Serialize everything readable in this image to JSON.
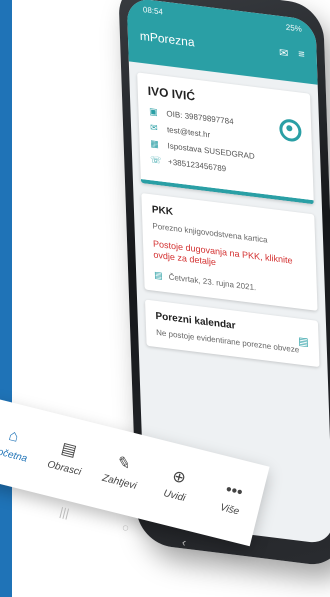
{
  "status_bar": {
    "time": "08:54",
    "battery": "25%"
  },
  "app": {
    "title": "mPorezna"
  },
  "user_card": {
    "name": "IVO IVIĆ",
    "oib": "OIB: 39879897784",
    "email": "test@test.hr",
    "office": "Ispostava SUSEDGRAD",
    "phone": "+385123456789"
  },
  "pkk_card": {
    "title": "PKK",
    "subtitle": "Porezno knjigovodstvena kartica",
    "warning": "Postoje dugovanja na PKK, kliknite ovdje za detalje",
    "date": "Četvrtak, 23. rujna 2021."
  },
  "calendar_card": {
    "title": "Porezni kalendar",
    "subtitle": "Ne postoje evidentirane porezne obveze"
  },
  "bottom_nav": [
    {
      "label": "Početna",
      "icon": "home-icon",
      "active": true
    },
    {
      "label": "Obrasci",
      "icon": "document-icon",
      "active": false
    },
    {
      "label": "Zahtjevi",
      "icon": "pencil-icon",
      "active": false
    },
    {
      "label": "Uvidi",
      "icon": "magnifier-icon",
      "active": false
    },
    {
      "label": "Više",
      "icon": "more-icon",
      "active": false
    }
  ],
  "colors": {
    "accent": "#2a9fa5",
    "warning": "#d32f2f",
    "brand_bar": "#1f73b7"
  }
}
